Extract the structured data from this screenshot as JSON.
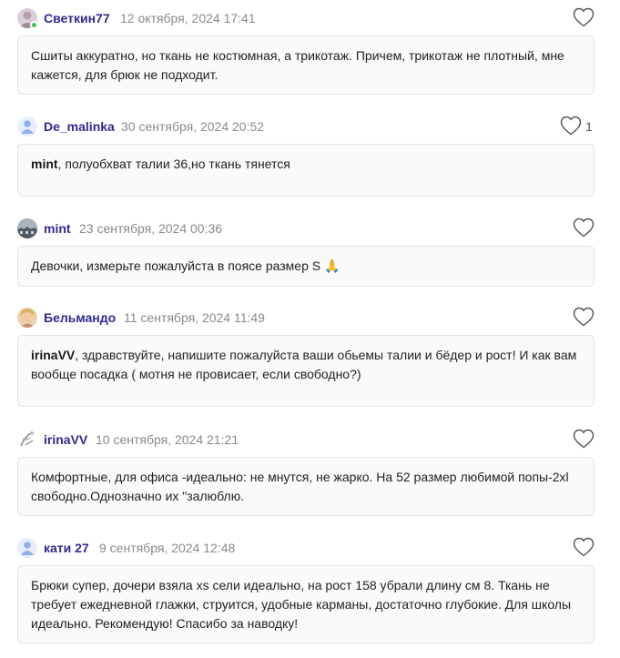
{
  "comments": [
    {
      "author": "Светкин77",
      "date": "12 октября, 2024 17:41",
      "mention": "",
      "text": "Сшиты аккуратно, но ткань не костюмная, а трикотаж. Причем, трикотаж не плотный, мне кажется, для брюк не подходит.",
      "likes": ""
    },
    {
      "author": "De_malinka",
      "date": "30 сентября, 2024 20:52",
      "mention": "mint",
      "text": ", полуобхват талии 36,но ткань тянется",
      "likes": "1"
    },
    {
      "author": "mint",
      "date": "23 сентября, 2024 00:36",
      "mention": "",
      "text": "Девочки, измерьте пожалуйста в поясе размер S 🙏",
      "likes": ""
    },
    {
      "author": "Бельмандо",
      "date": "11 сентября, 2024 11:49",
      "mention": "irinaVV",
      "text": ", здравствуйте, напишите пожалуйста ваши обьемы талии и бёдер и рост! И как вам вообще посадка ( мотня не провисает, если свободно?)",
      "likes": ""
    },
    {
      "author": "irinaVV",
      "date": "10 сентября, 2024 21:21",
      "mention": "",
      "text": "Комфортные, для офиса -идеально: не мнутся, не жарко. На 52 размер любимой попы-2xl свободно.Однозначно их \"залюблю.",
      "likes": ""
    },
    {
      "author": "кати 27",
      "date": "9 сентября, 2024 12:48",
      "mention": "",
      "text": "Брюки супер, дочери взяла xs сели идеально, на рост 158 убрали длину см 8. Ткань не требует ежедневной глажки, струится, удобные карманы, достаточно глубокие. Для школы идеально. Рекомендую! Спасибо за наводку!",
      "likes": ""
    }
  ]
}
